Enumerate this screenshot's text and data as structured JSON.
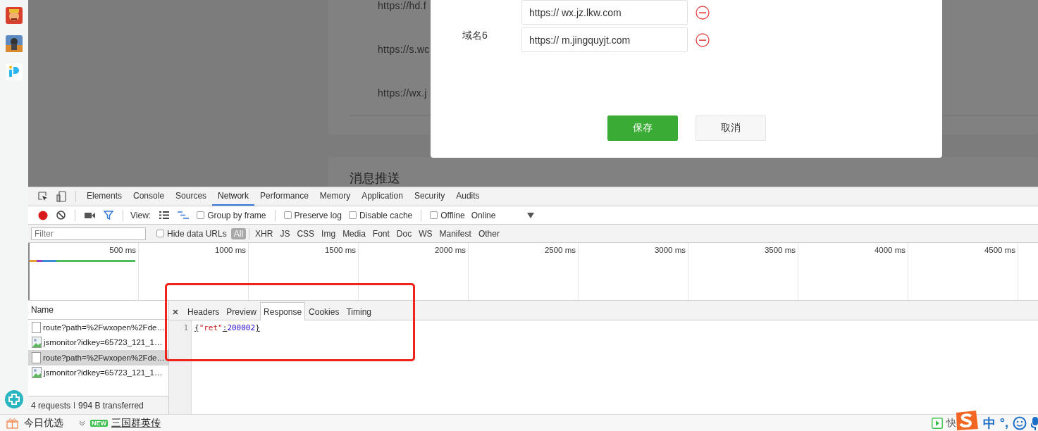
{
  "page": {
    "card_links": [
      "https://hd.f",
      "https://s.wc",
      "https://wx.j"
    ],
    "next_section_title": "消息推送"
  },
  "dialog": {
    "fields": [
      {
        "value": "https:// wx.jz.lkw.com"
      },
      {
        "label": "域名6",
        "value": "https:// m.jingquyjt.com"
      }
    ],
    "buttons": [
      {
        "label": "保存",
        "kind": "primary"
      },
      {
        "label": "取消",
        "kind": "default"
      }
    ]
  },
  "devtools": {
    "tabs": [
      {
        "label": "Elements",
        "selected": false
      },
      {
        "label": "Console",
        "selected": false
      },
      {
        "label": "Sources",
        "selected": false
      },
      {
        "label": "Network",
        "selected": true
      },
      {
        "label": "Performance",
        "selected": false
      },
      {
        "label": "Memory",
        "selected": false
      },
      {
        "label": "Application",
        "selected": false
      },
      {
        "label": "Security",
        "selected": false
      },
      {
        "label": "Audits",
        "selected": false
      }
    ],
    "toolbar": {
      "view_label": "View:",
      "group_by_frame": {
        "label": "Group by frame",
        "checked": false
      },
      "log_options": [
        {
          "label": "Preserve log",
          "checked": false
        },
        {
          "label": "Disable cache",
          "checked": false
        }
      ],
      "offline": {
        "label": "Offline",
        "checked": false
      },
      "throttling": "Online"
    },
    "filter": {
      "placeholder": "Filter",
      "hide_data_urls": {
        "label": "Hide data URLs",
        "checked": false
      },
      "types": [
        {
          "label": "All",
          "selected": true
        },
        {
          "label": "XHR",
          "selected": false
        },
        {
          "label": "JS",
          "selected": false
        },
        {
          "label": "CSS",
          "selected": false
        },
        {
          "label": "Img",
          "selected": false
        },
        {
          "label": "Media",
          "selected": false
        },
        {
          "label": "Font",
          "selected": false
        },
        {
          "label": "Doc",
          "selected": false
        },
        {
          "label": "WS",
          "selected": false
        },
        {
          "label": "Manifest",
          "selected": false
        },
        {
          "label": "Other",
          "selected": false
        }
      ]
    },
    "timeline_ticks": [
      "500 ms",
      "1000 ms",
      "1500 ms",
      "2000 ms",
      "2500 ms",
      "3000 ms",
      "3500 ms",
      "4000 ms",
      "4500 ms"
    ],
    "requests": {
      "column": "Name",
      "rows": [
        {
          "name": "route?path=%2Fwxopen%2Fde…",
          "kind": "document",
          "selected": false
        },
        {
          "name": "jsmonitor?idkey=65723_121_1…",
          "kind": "image",
          "selected": false
        },
        {
          "name": "route?path=%2Fwxopen%2Fde…",
          "kind": "document",
          "selected": true
        },
        {
          "name": "jsmonitor?idkey=65723_121_1…",
          "kind": "image",
          "selected": false
        }
      ],
      "count": "4 requests",
      "transferred": "994 B transferred"
    },
    "detail": {
      "tabs": [
        {
          "label": "Headers",
          "selected": false
        },
        {
          "label": "Preview",
          "selected": false
        },
        {
          "label": "Response",
          "selected": true
        },
        {
          "label": "Cookies",
          "selected": false
        },
        {
          "label": "Timing",
          "selected": false
        }
      ],
      "code_lines": [
        {
          "number": "1",
          "tokens": [
            {
              "text": "{",
              "kind": "punct"
            },
            {
              "text": "\"ret\"",
              "kind": "string"
            },
            {
              "text": ":",
              "kind": "punct"
            },
            {
              "text": "200002",
              "kind": "number"
            },
            {
              "text": "}",
              "kind": "punct"
            }
          ]
        }
      ]
    }
  },
  "status_bar": {
    "promo": "今日优选",
    "badge": "NEW",
    "game_link": "三国群英传",
    "app_label": "快",
    "ime_mode": "中",
    "ime_punct": "°,"
  }
}
